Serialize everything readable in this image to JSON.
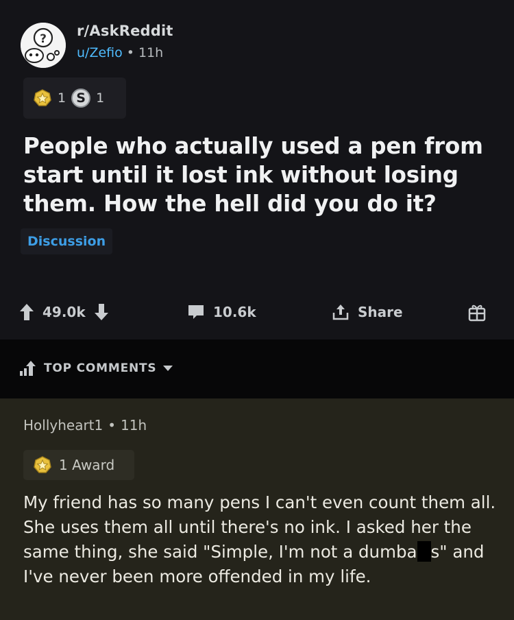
{
  "post": {
    "subreddit": "r/AskReddit",
    "author": "u/Zefio",
    "separator": "•",
    "age": "11h",
    "awards": [
      {
        "icon": "gold-award-icon",
        "count": "1"
      },
      {
        "icon": "silver-award-icon",
        "symbol": "S",
        "count": "1"
      }
    ],
    "title": "People who actually used a pen from start until it lost ink without losing them. How the hell did you do it?",
    "flair": "Discussion",
    "actions": {
      "score": "49.0k",
      "comments": "10.6k",
      "share": "Share"
    }
  },
  "sort_bar": {
    "label": "TOP COMMENTS"
  },
  "comment": {
    "author": "Hollyheart1",
    "separator": "•",
    "age": "11h",
    "award_label": "1 Award",
    "body_before_censor": "My friend has so many pens I can't even count them all. She uses them all until there's no ink. I asked her the same thing, she said \"Simple, I'm not a dumba",
    "body_after_censor": "s\" and I've never been more offended in my life."
  },
  "colors": {
    "post_bg": "#141418",
    "sortbar_bg": "#070708",
    "comment_bg": "#25241b",
    "username_link": "#4fbcff",
    "flair_text": "#3d9ee6",
    "gold_award": "#e9c13d"
  }
}
